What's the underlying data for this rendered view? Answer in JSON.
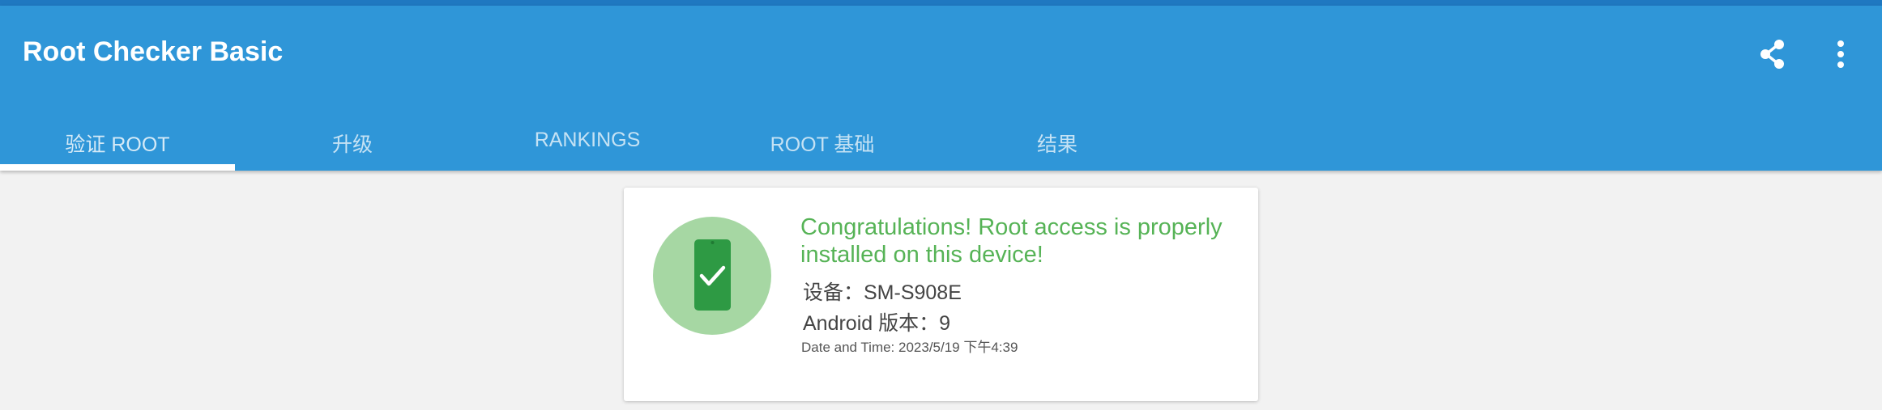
{
  "app": {
    "title": "Root Checker Basic"
  },
  "toolbar": {
    "share_icon": "share-icon",
    "more_icon": "more-vertical-icon"
  },
  "tabs": [
    {
      "label": "验证 ROOT",
      "active": true
    },
    {
      "label": "升级",
      "active": false
    },
    {
      "label": "RANKINGS",
      "active": false
    },
    {
      "label": "ROOT 基础",
      "active": false
    },
    {
      "label": "结果",
      "active": false
    }
  ],
  "result": {
    "message": "Congratulations! Root access is properly installed on this device!",
    "device": "设备：SM-S908E",
    "android": "Android 版本：9",
    "datetime": "Date and Time: 2023/5/19 下午4:39",
    "icon": "phone-check-icon"
  },
  "colors": {
    "appbar": "#2f96d8",
    "status_strip": "#1f78c1",
    "success_text": "#56b356",
    "badge_circle": "#a6d7a3",
    "phone": "#2e9a44"
  }
}
